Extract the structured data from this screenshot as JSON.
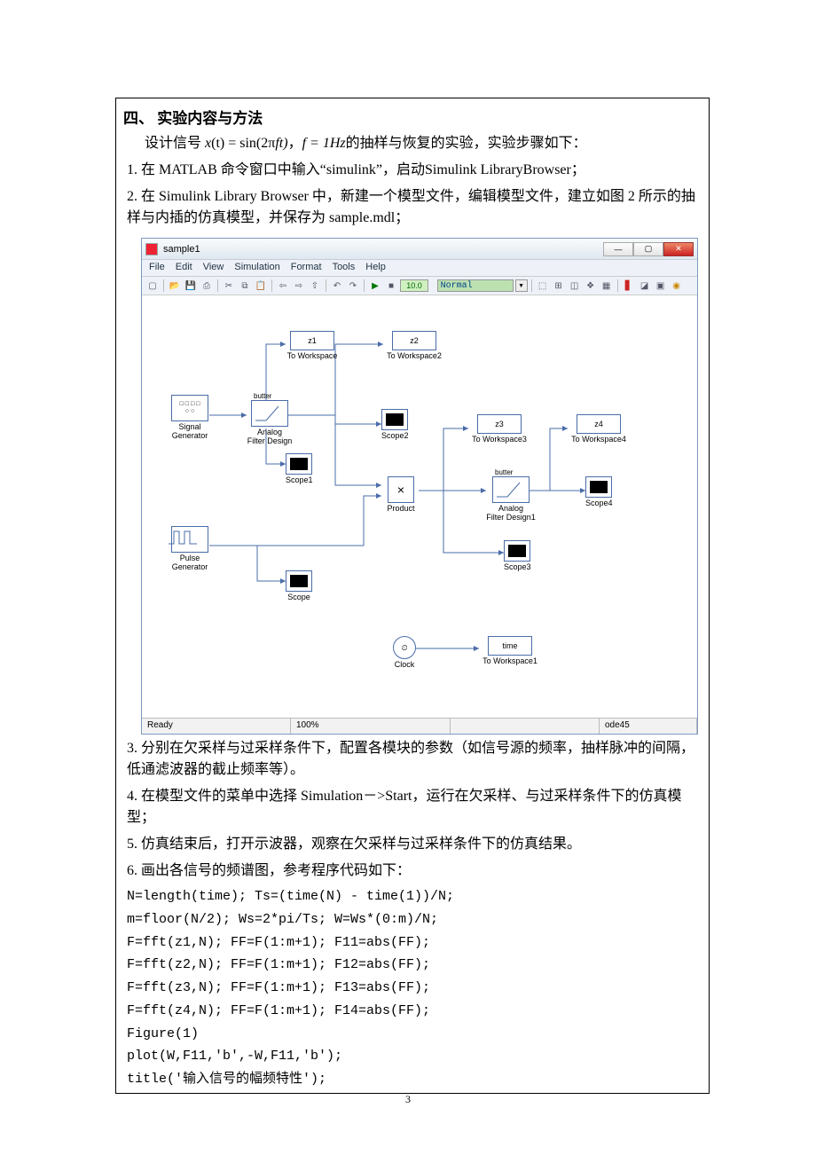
{
  "heading": "四、 实验内容与方法",
  "paras": {
    "intro_prefix": "设计信号 ",
    "intro_eq_prefix": "x",
    "intro_eq_middle": "(t) = sin(2π",
    "intro_eq_f": "f",
    "intro_eq_t": "t)",
    "intro_mid": "，",
    "intro_feq": "f = 1Hz",
    "intro_suffix": "的抽样与恢复的实验，实验步骤如下：",
    "p1": "1. 在 MATLAB 命令窗口中输入“simulink”，启动Simulink LibraryBrowser；",
    "p2": "2. 在 Simulink Library Browser 中，新建一个模型文件，编辑模型文件，建立如图 2 所示的抽样与内插的仿真模型，并保存为 sample.mdl；",
    "p3": "3. 分别在欠采样与过采样条件下，配置各模块的参数（如信号源的频率，抽样脉冲的间隔，低通滤波器的截止频率等）。",
    "p4": "4. 在模型文件的菜单中选择 Simulation－>Start，运行在欠采样、与过采样条件下的仿真模型；",
    "p5": "5. 仿真结束后，打开示波器，观察在欠采样与过采样条件下的仿真结果。",
    "p6": "6. 画出各信号的频谱图，参考程序代码如下："
  },
  "code": {
    "l1": "N=length(time); Ts=(time(N) - time(1))/N;",
    "l2": "m=floor(N/2); Ws=2*pi/Ts; W=Ws*(0:m)/N;",
    "l3": "F=fft(z1,N); FF=F(1:m+1); F11=abs(FF);",
    "l4": "F=fft(z2,N); FF=F(1:m+1); F12=abs(FF);",
    "l5": "F=fft(z3,N); FF=F(1:m+1); F13=abs(FF);",
    "l6": "F=fft(z4,N); FF=F(1:m+1); F14=abs(FF);",
    "l7": "Figure(1)",
    "l8": "plot(W,F11,'b',-W,F11,'b');",
    "l9": "title('输入信号的幅频特性');"
  },
  "window": {
    "title": "sample1",
    "menu": [
      "File",
      "Edit",
      "View",
      "Simulation",
      "Format",
      "Tools",
      "Help"
    ],
    "sim_time": "10.0",
    "sim_mode": "Normal",
    "status": {
      "ready": "Ready",
      "zoom": "100%",
      "solver": "ode45"
    }
  },
  "blocks": {
    "siggen": {
      "top": "□ □ □ □",
      "mid": "○ ○",
      "label": "Signal\nGenerator"
    },
    "butter1": {
      "txt": "butter",
      "label": "Analog\nFilter Design"
    },
    "butter2": {
      "txt": "butter",
      "label": "Analog\nFilter Design1"
    },
    "z1": {
      "txt": "z1",
      "label": "To Workspace"
    },
    "z2": {
      "txt": "z2",
      "label": "To Workspace2"
    },
    "z3": {
      "txt": "z3",
      "label": "To Workspace3"
    },
    "z4": {
      "txt": "z4",
      "label": "To Workspace4"
    },
    "time": {
      "txt": "time",
      "label": "To Workspace1"
    },
    "product": {
      "txt": "×",
      "label": "Product"
    },
    "clock": {
      "label": "Clock"
    },
    "pulse": {
      "label": "Pulse\nGenerator"
    },
    "scope": {
      "label": "Scope"
    },
    "scope1": {
      "label": "Scope1"
    },
    "scope2": {
      "label": "Scope2"
    },
    "scope3": {
      "label": "Scope3"
    },
    "scope4": {
      "label": "Scope4"
    }
  },
  "page_number": "3"
}
